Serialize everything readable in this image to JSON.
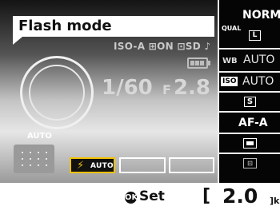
{
  "title": "Flash mode",
  "status_row": "ISO-A ⊞ON ⊡SD ♪",
  "shutter": "1/60",
  "aperture_prefix": "F",
  "aperture": "2.8",
  "auto_label": "AUTO",
  "flash_modes": {
    "selected": "AUTO",
    "slot2": "",
    "slot3": ""
  },
  "right_panel": {
    "qual_label": "QUAL",
    "quality": "NORM",
    "image_size": "L",
    "wb_label": "WB",
    "wb_value": "AUTO",
    "iso_label": "ISO",
    "iso_value": "AUTO",
    "release_mode": "S",
    "af_mode": "AF-A",
    "af_area": "[ ]",
    "metering": "⊡"
  },
  "bottom_bar": {
    "set_icon": "OK",
    "set_label": "Set",
    "bracket": "[",
    "shots_remaining": "2.0",
    "shots_unit": "]k"
  },
  "colors": {
    "accent": "#f2c200",
    "frame": "#ededed"
  }
}
